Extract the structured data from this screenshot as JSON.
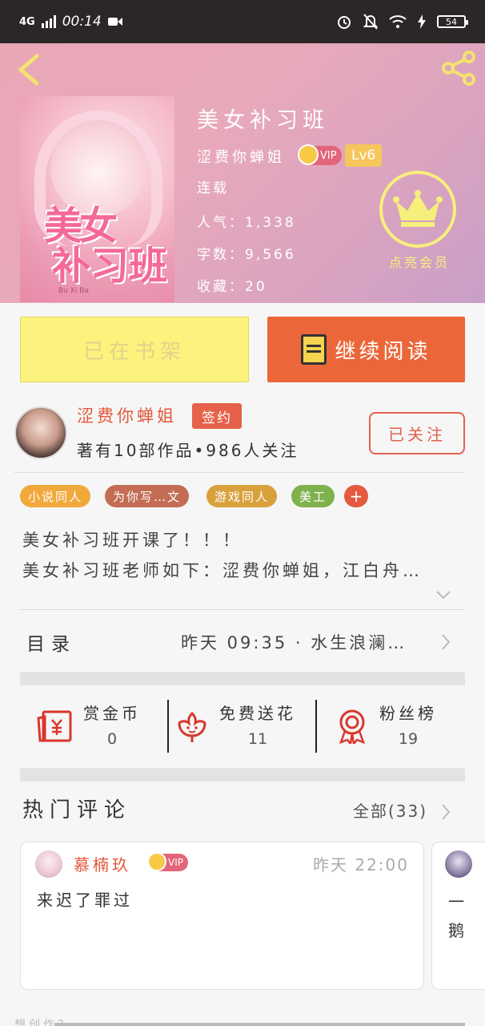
{
  "status_bar": {
    "network": "4G",
    "time": "00:14",
    "battery": "54"
  },
  "book": {
    "title": "美女补习班",
    "author": "涩费你蝉姐",
    "vip": "VIP",
    "level": "Lv6",
    "status": "连载",
    "popularity": "人气：1,338",
    "words": "字数：9,566",
    "favorites": "收藏：20",
    "vip_member_label": "点亮会员",
    "cover": {
      "title_line1": "美女",
      "title_line2": "补习班",
      "pinyin": "Bu Xi Ba"
    }
  },
  "actions": {
    "shelf": "已在书架",
    "read": "继续阅读"
  },
  "author_info": {
    "name": "涩费你蝉姐",
    "sign": "签约",
    "stats": "著有10部作品•986人关注",
    "follow": "已关注"
  },
  "tags": [
    {
      "label": "小说同人",
      "color": "#f2a93b"
    },
    {
      "label": "为你写…文",
      "color": "#c46d54"
    },
    {
      "label": "游戏同人",
      "color": "#d9a13c"
    },
    {
      "label": "美工",
      "color": "#7fb24c"
    }
  ],
  "tag_more": "+",
  "description": {
    "line1": "美女补习班开课了！！！",
    "line2": "美女补习班老师如下：涩费你蝉姐，江白舟…"
  },
  "toc": {
    "label": "目录",
    "latest": "昨天 09:35 · 水生浪澜…"
  },
  "stats": [
    {
      "label": "赏金币",
      "value": "0",
      "icon": "red-envelope-icon"
    },
    {
      "label": "免费送花",
      "value": "11",
      "icon": "flower-icon"
    },
    {
      "label": "粉丝榜",
      "value": "19",
      "icon": "medal-icon"
    }
  ],
  "comments": {
    "title": "热门评论",
    "all": "全部(33)",
    "items": [
      {
        "name": "慕楠玖",
        "vip": "VIP",
        "time": "昨天 22:00",
        "text": "来迟了罪过"
      }
    ],
    "peek_line1": "一",
    "peek_line2": "鹅"
  },
  "bottom_peek": "想创作？"
}
